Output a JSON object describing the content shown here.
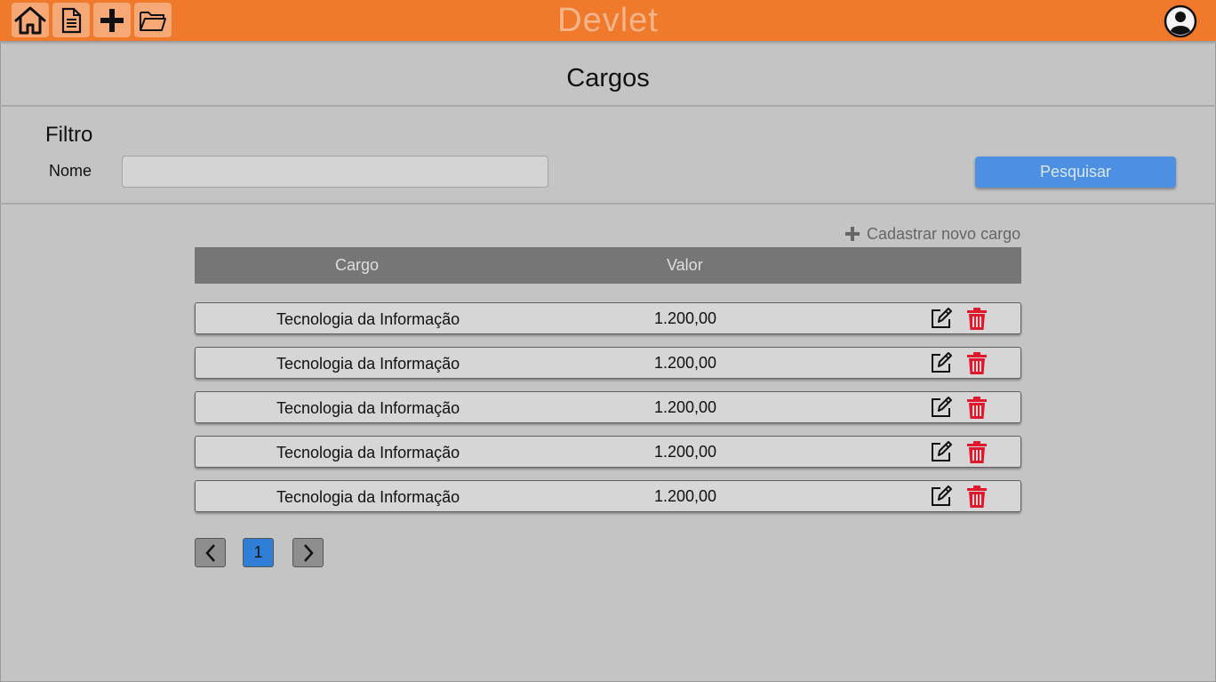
{
  "header": {
    "brand": "Devlet",
    "nav": [
      {
        "name": "home-icon"
      },
      {
        "name": "document-icon"
      },
      {
        "name": "plus-icon"
      },
      {
        "name": "folder-icon"
      }
    ],
    "user_icon": "user-circle-icon"
  },
  "page": {
    "title": "Cargos"
  },
  "filter": {
    "title": "Filtro",
    "name_label": "Nome",
    "name_value": "",
    "name_placeholder": "",
    "search_label": "Pesquisar"
  },
  "actions": {
    "new_label": "Cadastrar novo cargo"
  },
  "table": {
    "columns": [
      "Cargo",
      "Valor"
    ],
    "rows": [
      {
        "cargo": "Tecnologia da Informação",
        "valor": "1.200,00"
      },
      {
        "cargo": "Tecnologia da Informação",
        "valor": "1.200,00"
      },
      {
        "cargo": "Tecnologia da Informação",
        "valor": "1.200,00"
      },
      {
        "cargo": "Tecnologia da Informação",
        "valor": "1.200,00"
      },
      {
        "cargo": "Tecnologia da Informação",
        "valor": "1.200,00"
      }
    ]
  },
  "pagination": {
    "current": "1"
  },
  "colors": {
    "accent": "#ef7a2c",
    "primary": "#4d90e1",
    "danger": "#e0182d"
  }
}
